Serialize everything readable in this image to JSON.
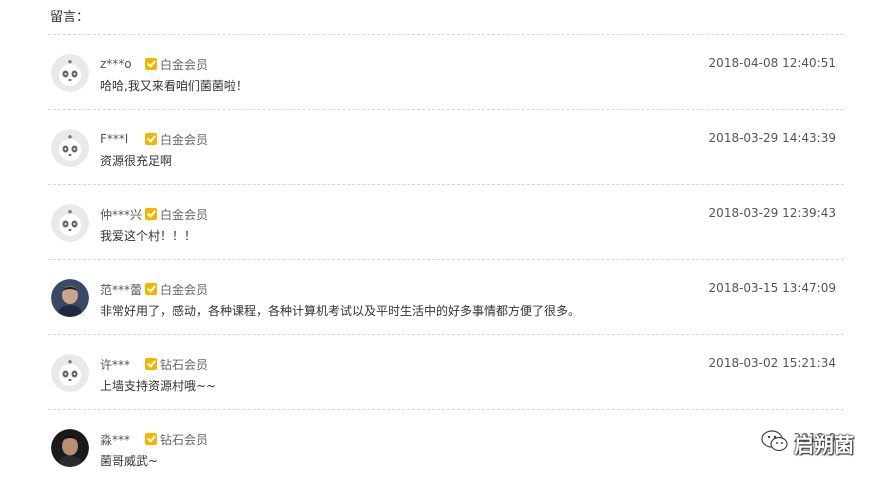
{
  "header": {
    "title": "留言："
  },
  "comments": [
    {
      "user": "z***o",
      "level": "白金会员",
      "time": "2018-04-08 12:40:51",
      "text": "哈哈,我又来看咱们菌菌啦！",
      "avatar": "panda-avatar"
    },
    {
      "user": "F***l",
      "level": "白金会员",
      "time": "2018-03-29 14:43:39",
      "text": "资源很充足啊",
      "avatar": "panda-avatar"
    },
    {
      "user": "仲***兴",
      "level": "白金会员",
      "time": "2018-03-29 12:39:43",
      "text": "我爱这个村！！！",
      "avatar": "panda-avatar"
    },
    {
      "user": "范***蕾",
      "level": "白金会员",
      "time": "2018-03-15 13:47:09",
      "text": "非常好用了，感动，各种课程，各种计算机考试以及平时生活中的好多事情都方便了很多。",
      "avatar": "photo-avatar"
    },
    {
      "user": "许***",
      "level": "钻石会员",
      "time": "2018-03-02 15:21:34",
      "text": "上墙支持资源村哦~~",
      "avatar": "panda-avatar"
    },
    {
      "user": "淼***",
      "level": "钻石会员",
      "time": "2018-0",
      "text": "菌哥威武~",
      "avatar": "photo-avatar-dark"
    }
  ],
  "watermark": {
    "text": "启朔菌",
    "icon": "wechat-icon"
  }
}
